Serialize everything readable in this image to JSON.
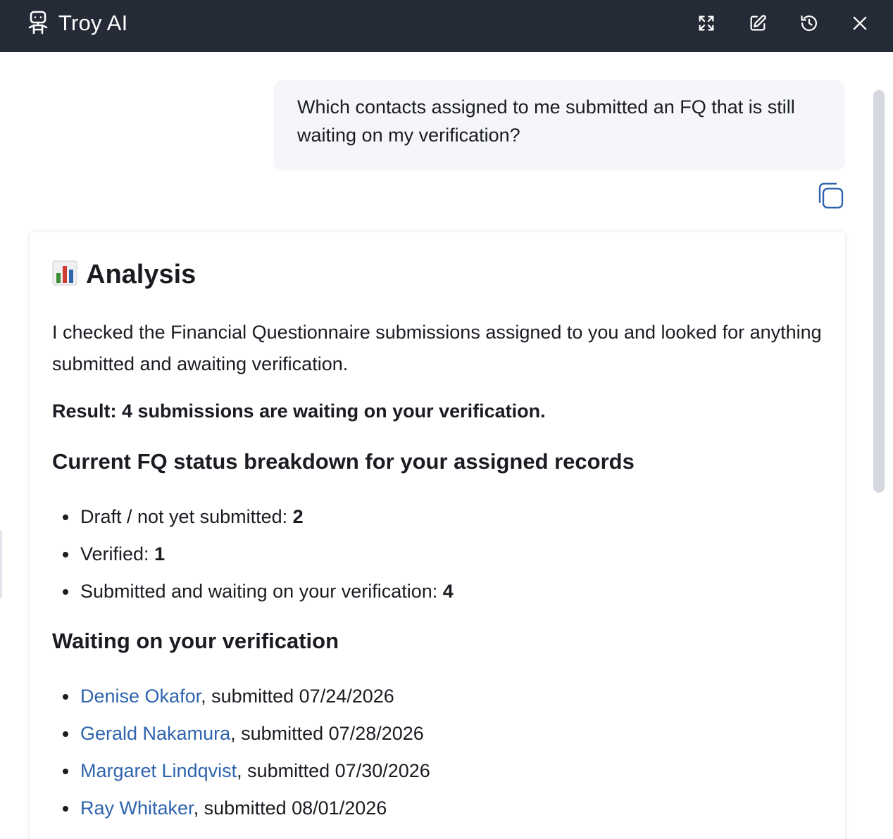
{
  "header": {
    "title": "Troy AI",
    "icons": {
      "logo": "robot-icon",
      "expand": "expand-icon",
      "edit": "edit-icon",
      "history": "history-icon",
      "close": "close-icon"
    },
    "background": "#252a37"
  },
  "conversation": {
    "user_message": "Which contacts assigned to me submitted an FQ that is still waiting on my verification?",
    "copy_icon": "copy-icon",
    "answer": {
      "heading_icon": "bar-chart-icon",
      "heading": "Analysis",
      "intro": "I checked the Financial Questionnaire submissions assigned to you and looked for anything submitted and awaiting verification.",
      "result": "Result: 4 submissions are waiting on your verification.",
      "status_heading": "Current FQ status breakdown for your assigned records",
      "status_items": [
        {
          "label": "Draft / not yet submitted: ",
          "count": "2"
        },
        {
          "label": "Verified: ",
          "count": "1"
        },
        {
          "label": "Submitted and waiting on your verification: ",
          "count": "4"
        }
      ],
      "waiting_heading": "Waiting on your verification",
      "waiting_items": [
        {
          "name": "Denise Okafor",
          "detail": ", submitted 07/24/2026"
        },
        {
          "name": "Gerald Nakamura",
          "detail": ", submitted 07/28/2026"
        },
        {
          "name": "Margaret Lindqvist",
          "detail": ", submitted 07/30/2026"
        },
        {
          "name": "Ray Whitaker",
          "detail": ", submitted 08/01/2026"
        }
      ]
    }
  },
  "colors": {
    "link": "#2f64ae",
    "bubble": "#f4f6fa"
  }
}
